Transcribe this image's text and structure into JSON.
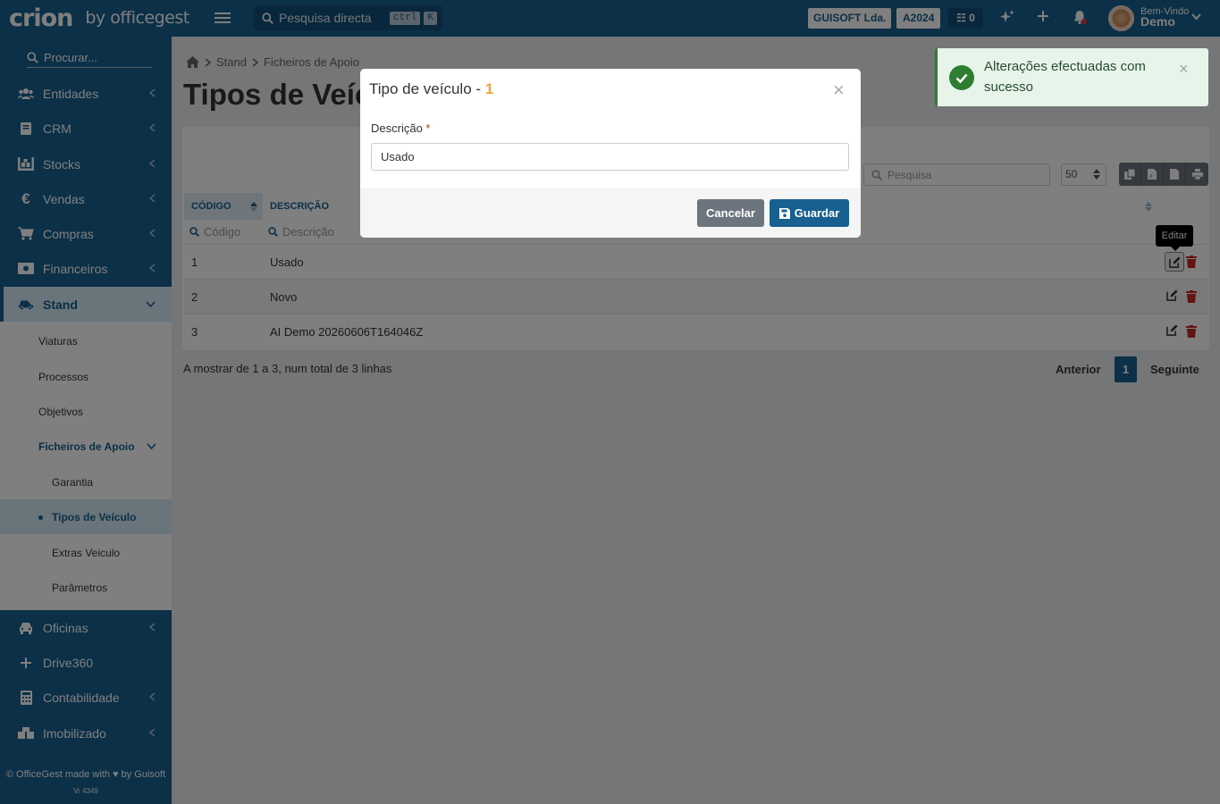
{
  "topbar": {
    "brand": "crion",
    "by": "by officegest",
    "search_placeholder": "Pesquisa directa",
    "kbd_ctrl": "ctrl",
    "kbd_k": "K",
    "company": "GUISOFT Lda.",
    "year": "A2024",
    "tasks_count": "0",
    "welcome_small": "Bem-Vindo",
    "welcome_user": "Demo"
  },
  "sidebar": {
    "search_placeholder": "Procurar...",
    "items": [
      {
        "label": "Entidades",
        "icon": "users-icon"
      },
      {
        "label": "CRM",
        "icon": "book-icon"
      },
      {
        "label": "Stocks",
        "icon": "warehouse-icon"
      },
      {
        "label": "Vendas",
        "icon": "euro-icon"
      },
      {
        "label": "Compras",
        "icon": "cart-icon"
      },
      {
        "label": "Financeiros",
        "icon": "money-icon"
      },
      {
        "label": "Stand",
        "icon": "car-side-icon"
      },
      {
        "label": "Oficinas",
        "icon": "car-icon"
      },
      {
        "label": "Drive360",
        "icon": "plus-icon"
      },
      {
        "label": "Contabilidade",
        "icon": "calculator-icon"
      },
      {
        "label": "Imobilizado",
        "icon": "boxes-icon"
      }
    ],
    "stand_sub": [
      "Viaturas",
      "Processos",
      "Objetivos",
      "Ficheiros de Apoio"
    ],
    "ficheiros_sub": [
      "Garantia",
      "Tipos de Veículo",
      "Extras Veiculo",
      "Parâmetros"
    ],
    "footer": "© OfficeGest made with ♥ by Guisoft",
    "version": "Vr 4349"
  },
  "breadcrumb": {
    "home_icon": "home-icon",
    "items": [
      "Stand",
      "Ficheiros de Apoio"
    ]
  },
  "page_title": "Tipos de Veículo",
  "table": {
    "search_placeholder": "Pesquisa",
    "page_size": "50",
    "columns": [
      "CÓDIGO",
      "DESCRIÇÃO"
    ],
    "filters": [
      "Código",
      "Descrição"
    ],
    "rows": [
      {
        "code": "1",
        "desc": "Usado"
      },
      {
        "code": "2",
        "desc": "Novo"
      },
      {
        "code": "3",
        "desc": "AI Demo 20260606T164046Z"
      }
    ],
    "tooltip": "Editar",
    "info": "A mostrar de 1 a 3, num total de 3 linhas",
    "prev": "Anterior",
    "page": "1",
    "next": "Seguinte"
  },
  "modal": {
    "title": "Tipo de veículo - ",
    "title_num": "1",
    "close": "×",
    "field_label": "Descrição",
    "required_mark": "*",
    "field_value": "Usado",
    "cancel": "Cancelar",
    "save": "Guardar"
  },
  "toast": {
    "message": "Alterações efectuadas com sucesso",
    "close": "×"
  },
  "colors": {
    "primary": "#17608f",
    "accent": "#f0a33a",
    "success": "#2e7d32",
    "danger": "#c62828"
  }
}
